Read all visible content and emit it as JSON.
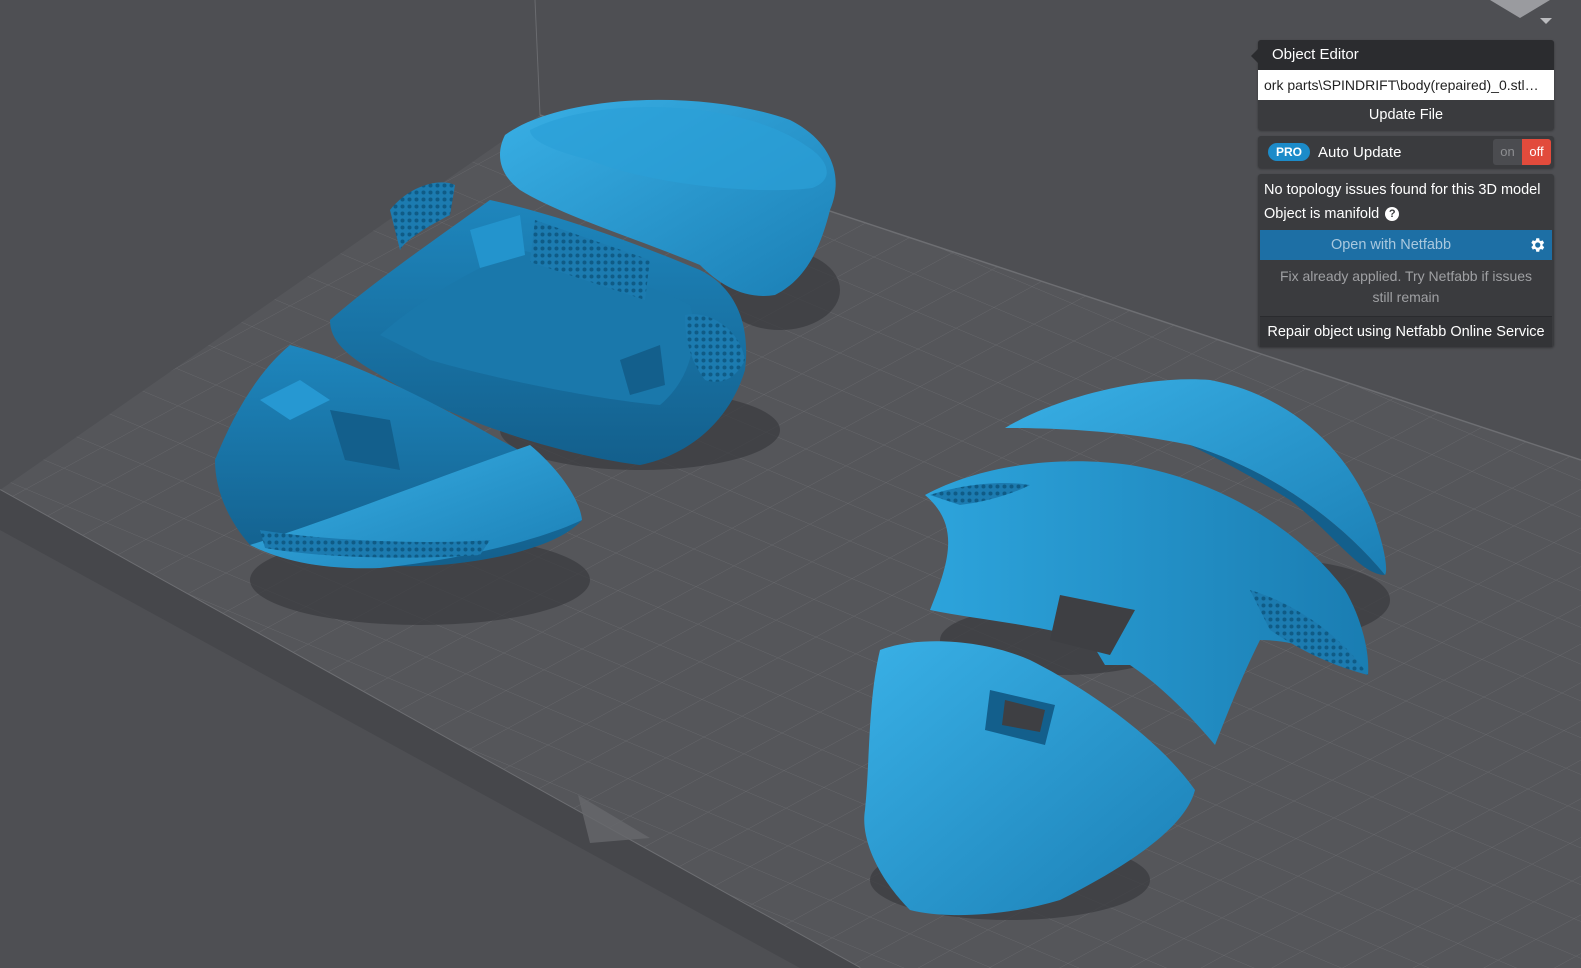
{
  "object_editor": {
    "title": "Object Editor",
    "file_path": "…ork parts\\SPINDRIFT\\body(repaired)_0.stl",
    "update_file_label": "Update File",
    "auto_update": {
      "badge": "PRO",
      "label": "Auto Update",
      "on_label": "on",
      "off_label": "off",
      "selected": "off"
    },
    "status": {
      "topology_message": "No topology issues found for this 3D model",
      "manifold_message": "Object is manifold",
      "help_icon": "?"
    },
    "netfabb": {
      "open_label": "Open with Netfabb",
      "hint": "Fix already applied. Try Netfabb if issues still remain",
      "repair_label": "Repair object using Netfabb Online Service"
    }
  },
  "icons": [
    "help-icon",
    "gear-icon",
    "view-cube-icon"
  ],
  "colors": {
    "background": "#4e4f53",
    "model_blue": "#2a9bd4",
    "accent_blue": "#1d6fa5",
    "off_red": "#e24b3c",
    "pro_badge": "#1c8bc9"
  }
}
